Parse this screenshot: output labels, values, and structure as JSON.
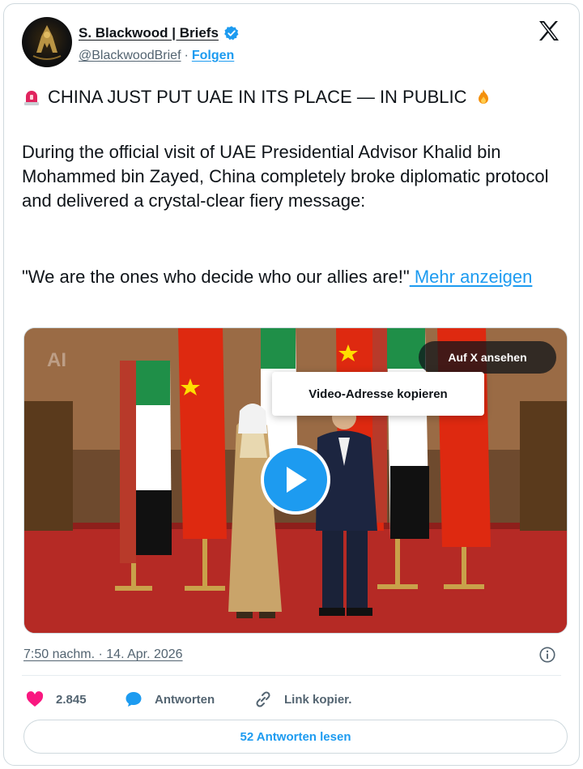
{
  "author": {
    "display_name": "S. Blackwood | Briefs",
    "handle": "@BlackwoodBrief",
    "separator": "·",
    "follow_label": "Folgen"
  },
  "post": {
    "headline": "CHINA JUST PUT UAE IN ITS PLACE — IN PUBLIC",
    "body": "During the official visit of UAE Presidential Advisor Khalid bin Mohammed bin Zayed, China completely broke diplomatic protocol and delivered a crystal-clear fiery message:",
    "quote": "\"We are the ones who decide who our allies are!\"",
    "more_link": " Mehr anzeigen",
    "timestamp": "7:50 nachm. · 14. Apr. 2026"
  },
  "media": {
    "watermark": "AI",
    "view_on_x_label": "Auf X ansehen",
    "context_menu_item": "Video-Adresse kopieren"
  },
  "actions": {
    "like_count": "2.845",
    "reply_label": "Antworten",
    "copy_link_label": "Link kopier.",
    "read_replies_label": "52 Antworten lesen"
  },
  "colors": {
    "accent": "#1d9bf0",
    "like": "#f91880",
    "text": "#0f1419",
    "muted": "#536471"
  },
  "icons": [
    "verified-badge-icon",
    "x-logo-icon",
    "siren-icon",
    "fire-icon",
    "play-icon",
    "info-icon",
    "heart-icon",
    "reply-bubble-icon",
    "link-icon"
  ]
}
